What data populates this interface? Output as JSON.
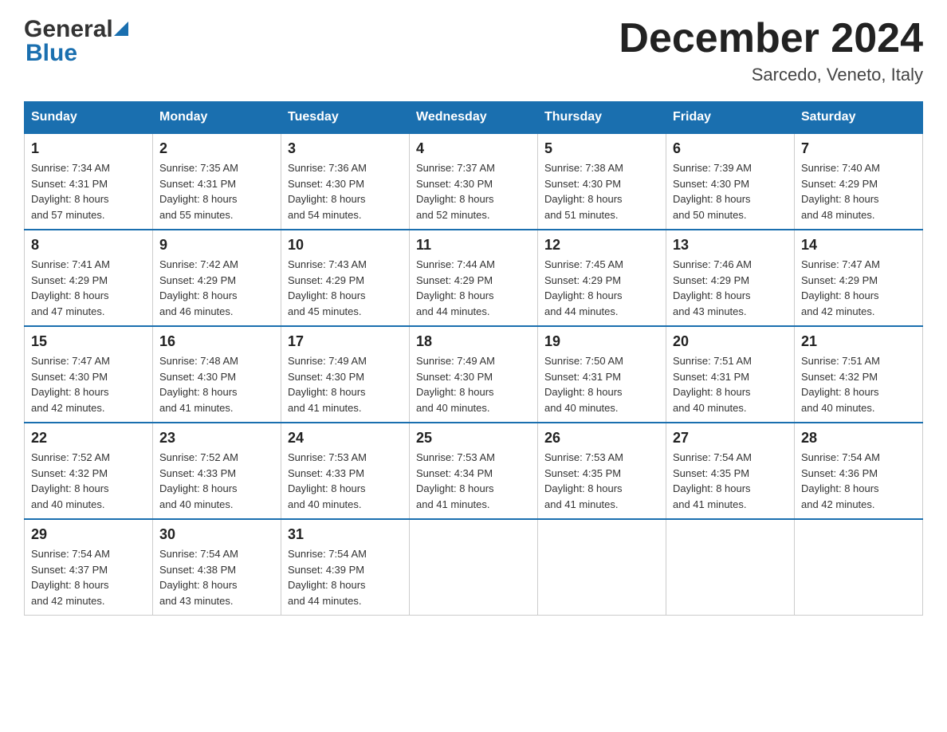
{
  "header": {
    "title": "December 2024",
    "subtitle": "Sarcedo, Veneto, Italy",
    "logo_general": "General",
    "logo_blue": "Blue"
  },
  "weekdays": [
    "Sunday",
    "Monday",
    "Tuesday",
    "Wednesday",
    "Thursday",
    "Friday",
    "Saturday"
  ],
  "weeks": [
    [
      {
        "day": "1",
        "sunrise": "Sunrise: 7:34 AM",
        "sunset": "Sunset: 4:31 PM",
        "daylight": "Daylight: 8 hours",
        "daylight2": "and 57 minutes."
      },
      {
        "day": "2",
        "sunrise": "Sunrise: 7:35 AM",
        "sunset": "Sunset: 4:31 PM",
        "daylight": "Daylight: 8 hours",
        "daylight2": "and 55 minutes."
      },
      {
        "day": "3",
        "sunrise": "Sunrise: 7:36 AM",
        "sunset": "Sunset: 4:30 PM",
        "daylight": "Daylight: 8 hours",
        "daylight2": "and 54 minutes."
      },
      {
        "day": "4",
        "sunrise": "Sunrise: 7:37 AM",
        "sunset": "Sunset: 4:30 PM",
        "daylight": "Daylight: 8 hours",
        "daylight2": "and 52 minutes."
      },
      {
        "day": "5",
        "sunrise": "Sunrise: 7:38 AM",
        "sunset": "Sunset: 4:30 PM",
        "daylight": "Daylight: 8 hours",
        "daylight2": "and 51 minutes."
      },
      {
        "day": "6",
        "sunrise": "Sunrise: 7:39 AM",
        "sunset": "Sunset: 4:30 PM",
        "daylight": "Daylight: 8 hours",
        "daylight2": "and 50 minutes."
      },
      {
        "day": "7",
        "sunrise": "Sunrise: 7:40 AM",
        "sunset": "Sunset: 4:29 PM",
        "daylight": "Daylight: 8 hours",
        "daylight2": "and 48 minutes."
      }
    ],
    [
      {
        "day": "8",
        "sunrise": "Sunrise: 7:41 AM",
        "sunset": "Sunset: 4:29 PM",
        "daylight": "Daylight: 8 hours",
        "daylight2": "and 47 minutes."
      },
      {
        "day": "9",
        "sunrise": "Sunrise: 7:42 AM",
        "sunset": "Sunset: 4:29 PM",
        "daylight": "Daylight: 8 hours",
        "daylight2": "and 46 minutes."
      },
      {
        "day": "10",
        "sunrise": "Sunrise: 7:43 AM",
        "sunset": "Sunset: 4:29 PM",
        "daylight": "Daylight: 8 hours",
        "daylight2": "and 45 minutes."
      },
      {
        "day": "11",
        "sunrise": "Sunrise: 7:44 AM",
        "sunset": "Sunset: 4:29 PM",
        "daylight": "Daylight: 8 hours",
        "daylight2": "and 44 minutes."
      },
      {
        "day": "12",
        "sunrise": "Sunrise: 7:45 AM",
        "sunset": "Sunset: 4:29 PM",
        "daylight": "Daylight: 8 hours",
        "daylight2": "and 44 minutes."
      },
      {
        "day": "13",
        "sunrise": "Sunrise: 7:46 AM",
        "sunset": "Sunset: 4:29 PM",
        "daylight": "Daylight: 8 hours",
        "daylight2": "and 43 minutes."
      },
      {
        "day": "14",
        "sunrise": "Sunrise: 7:47 AM",
        "sunset": "Sunset: 4:29 PM",
        "daylight": "Daylight: 8 hours",
        "daylight2": "and 42 minutes."
      }
    ],
    [
      {
        "day": "15",
        "sunrise": "Sunrise: 7:47 AM",
        "sunset": "Sunset: 4:30 PM",
        "daylight": "Daylight: 8 hours",
        "daylight2": "and 42 minutes."
      },
      {
        "day": "16",
        "sunrise": "Sunrise: 7:48 AM",
        "sunset": "Sunset: 4:30 PM",
        "daylight": "Daylight: 8 hours",
        "daylight2": "and 41 minutes."
      },
      {
        "day": "17",
        "sunrise": "Sunrise: 7:49 AM",
        "sunset": "Sunset: 4:30 PM",
        "daylight": "Daylight: 8 hours",
        "daylight2": "and 41 minutes."
      },
      {
        "day": "18",
        "sunrise": "Sunrise: 7:49 AM",
        "sunset": "Sunset: 4:30 PM",
        "daylight": "Daylight: 8 hours",
        "daylight2": "and 40 minutes."
      },
      {
        "day": "19",
        "sunrise": "Sunrise: 7:50 AM",
        "sunset": "Sunset: 4:31 PM",
        "daylight": "Daylight: 8 hours",
        "daylight2": "and 40 minutes."
      },
      {
        "day": "20",
        "sunrise": "Sunrise: 7:51 AM",
        "sunset": "Sunset: 4:31 PM",
        "daylight": "Daylight: 8 hours",
        "daylight2": "and 40 minutes."
      },
      {
        "day": "21",
        "sunrise": "Sunrise: 7:51 AM",
        "sunset": "Sunset: 4:32 PM",
        "daylight": "Daylight: 8 hours",
        "daylight2": "and 40 minutes."
      }
    ],
    [
      {
        "day": "22",
        "sunrise": "Sunrise: 7:52 AM",
        "sunset": "Sunset: 4:32 PM",
        "daylight": "Daylight: 8 hours",
        "daylight2": "and 40 minutes."
      },
      {
        "day": "23",
        "sunrise": "Sunrise: 7:52 AM",
        "sunset": "Sunset: 4:33 PM",
        "daylight": "Daylight: 8 hours",
        "daylight2": "and 40 minutes."
      },
      {
        "day": "24",
        "sunrise": "Sunrise: 7:53 AM",
        "sunset": "Sunset: 4:33 PM",
        "daylight": "Daylight: 8 hours",
        "daylight2": "and 40 minutes."
      },
      {
        "day": "25",
        "sunrise": "Sunrise: 7:53 AM",
        "sunset": "Sunset: 4:34 PM",
        "daylight": "Daylight: 8 hours",
        "daylight2": "and 41 minutes."
      },
      {
        "day": "26",
        "sunrise": "Sunrise: 7:53 AM",
        "sunset": "Sunset: 4:35 PM",
        "daylight": "Daylight: 8 hours",
        "daylight2": "and 41 minutes."
      },
      {
        "day": "27",
        "sunrise": "Sunrise: 7:54 AM",
        "sunset": "Sunset: 4:35 PM",
        "daylight": "Daylight: 8 hours",
        "daylight2": "and 41 minutes."
      },
      {
        "day": "28",
        "sunrise": "Sunrise: 7:54 AM",
        "sunset": "Sunset: 4:36 PM",
        "daylight": "Daylight: 8 hours",
        "daylight2": "and 42 minutes."
      }
    ],
    [
      {
        "day": "29",
        "sunrise": "Sunrise: 7:54 AM",
        "sunset": "Sunset: 4:37 PM",
        "daylight": "Daylight: 8 hours",
        "daylight2": "and 42 minutes."
      },
      {
        "day": "30",
        "sunrise": "Sunrise: 7:54 AM",
        "sunset": "Sunset: 4:38 PM",
        "daylight": "Daylight: 8 hours",
        "daylight2": "and 43 minutes."
      },
      {
        "day": "31",
        "sunrise": "Sunrise: 7:54 AM",
        "sunset": "Sunset: 4:39 PM",
        "daylight": "Daylight: 8 hours",
        "daylight2": "and 44 minutes."
      },
      {
        "day": "",
        "sunrise": "",
        "sunset": "",
        "daylight": "",
        "daylight2": ""
      },
      {
        "day": "",
        "sunrise": "",
        "sunset": "",
        "daylight": "",
        "daylight2": ""
      },
      {
        "day": "",
        "sunrise": "",
        "sunset": "",
        "daylight": "",
        "daylight2": ""
      },
      {
        "day": "",
        "sunrise": "",
        "sunset": "",
        "daylight": "",
        "daylight2": ""
      }
    ]
  ]
}
